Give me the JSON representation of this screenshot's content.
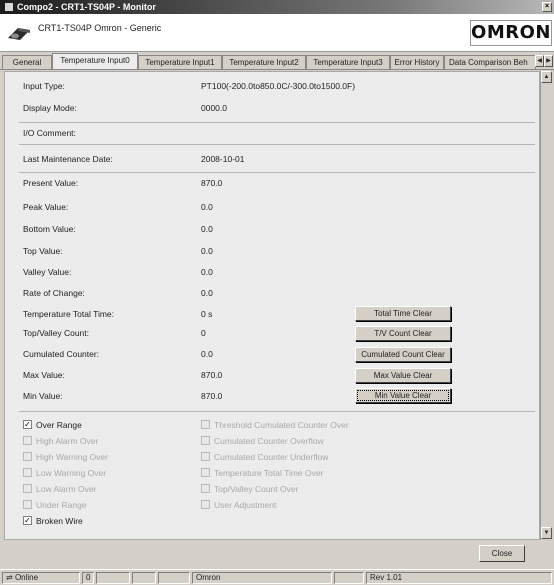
{
  "window": {
    "title": "Compo2 - CRT1-TS04P - Monitor",
    "close_glyph": "×"
  },
  "header": {
    "device_name": "CRT1-TS04P  Omron - Generic",
    "logo": "OMRON"
  },
  "tabs": [
    {
      "label": "General",
      "active": false
    },
    {
      "label": "Temperature Input0",
      "active": true
    },
    {
      "label": "Temperature Input1",
      "active": false
    },
    {
      "label": "Temperature Input2",
      "active": false
    },
    {
      "label": "Temperature Input3",
      "active": false
    },
    {
      "label": "Error History",
      "active": false
    },
    {
      "label": "Data Comparison Beh",
      "active": false
    }
  ],
  "fields": {
    "input_type": {
      "label": "Input Type:",
      "value": "PT100(-200.0to850.0C/-300.0to1500.0F)"
    },
    "display_mode": {
      "label": "Display Mode:",
      "value": "0000.0"
    },
    "io_comment": {
      "label": "I/O Comment:",
      "value": ""
    },
    "last_maintenance": {
      "label": "Last Maintenance Date:",
      "value": "2008-10-01"
    },
    "present_value": {
      "label": "Present Value:",
      "value": "870.0"
    },
    "peak_value": {
      "label": "Peak Value:",
      "value": "0.0"
    },
    "bottom_value": {
      "label": "Bottom Value:",
      "value": "0.0"
    },
    "top_value": {
      "label": "Top Value:",
      "value": "0.0"
    },
    "valley_value": {
      "label": "Valley Value:",
      "value": "0.0"
    },
    "rate_of_change": {
      "label": "Rate of Change:",
      "value": "0.0"
    },
    "temp_total_time": {
      "label": "Temperature Total Time:",
      "value": "0 s"
    },
    "top_valley_count": {
      "label": "Top/Valley Count:",
      "value": "0"
    },
    "cumulated_counter": {
      "label": "Cumulated Counter:",
      "value": "0.0"
    },
    "max_value": {
      "label": "Max Value:",
      "value": "870.0"
    },
    "min_value": {
      "label": "Min Value:",
      "value": "870.0"
    }
  },
  "buttons": {
    "total_time_clear": "Total Time Clear",
    "tv_count_clear": "T/V Count Clear",
    "cumulated_count_clear": "Cumulated Count Clear",
    "max_value_clear": "Max Value Clear",
    "min_value_clear": "Min Value Clear",
    "close": "Close"
  },
  "status_flags_left": [
    {
      "label": "Over Range",
      "checked": true,
      "enabled": true
    },
    {
      "label": "High Alarm Over",
      "checked": false,
      "enabled": false
    },
    {
      "label": "High Warning Over",
      "checked": false,
      "enabled": false
    },
    {
      "label": "Low Warning Over",
      "checked": false,
      "enabled": false
    },
    {
      "label": "Low Alarm Over",
      "checked": false,
      "enabled": false
    },
    {
      "label": "Under Range",
      "checked": false,
      "enabled": false
    },
    {
      "label": "Broken Wire",
      "checked": true,
      "enabled": true
    }
  ],
  "status_flags_right": [
    {
      "label": "Threshold Cumulated Counter Over",
      "checked": false,
      "enabled": false
    },
    {
      "label": "Cumulated Counter Overflow",
      "checked": false,
      "enabled": false
    },
    {
      "label": "Cumulated Counter Underflow",
      "checked": false,
      "enabled": false
    },
    {
      "label": "Temperature Total Time Over",
      "checked": false,
      "enabled": false
    },
    {
      "label": "Top/Valley Count Over",
      "checked": false,
      "enabled": false
    },
    {
      "label": "User Adjustment",
      "checked": false,
      "enabled": false
    }
  ],
  "statusbar": {
    "mode": "Online",
    "indicator": "0",
    "vendor": "Omron",
    "revision": "Rev 1.01"
  },
  "icons": {
    "online_icon": "network-plug-icon",
    "device_icon": "device-icon"
  },
  "colors": {
    "panel_bg": "#ececec",
    "chrome_bg": "#d4d0c8",
    "disabled_text": "#a8a8a8"
  }
}
